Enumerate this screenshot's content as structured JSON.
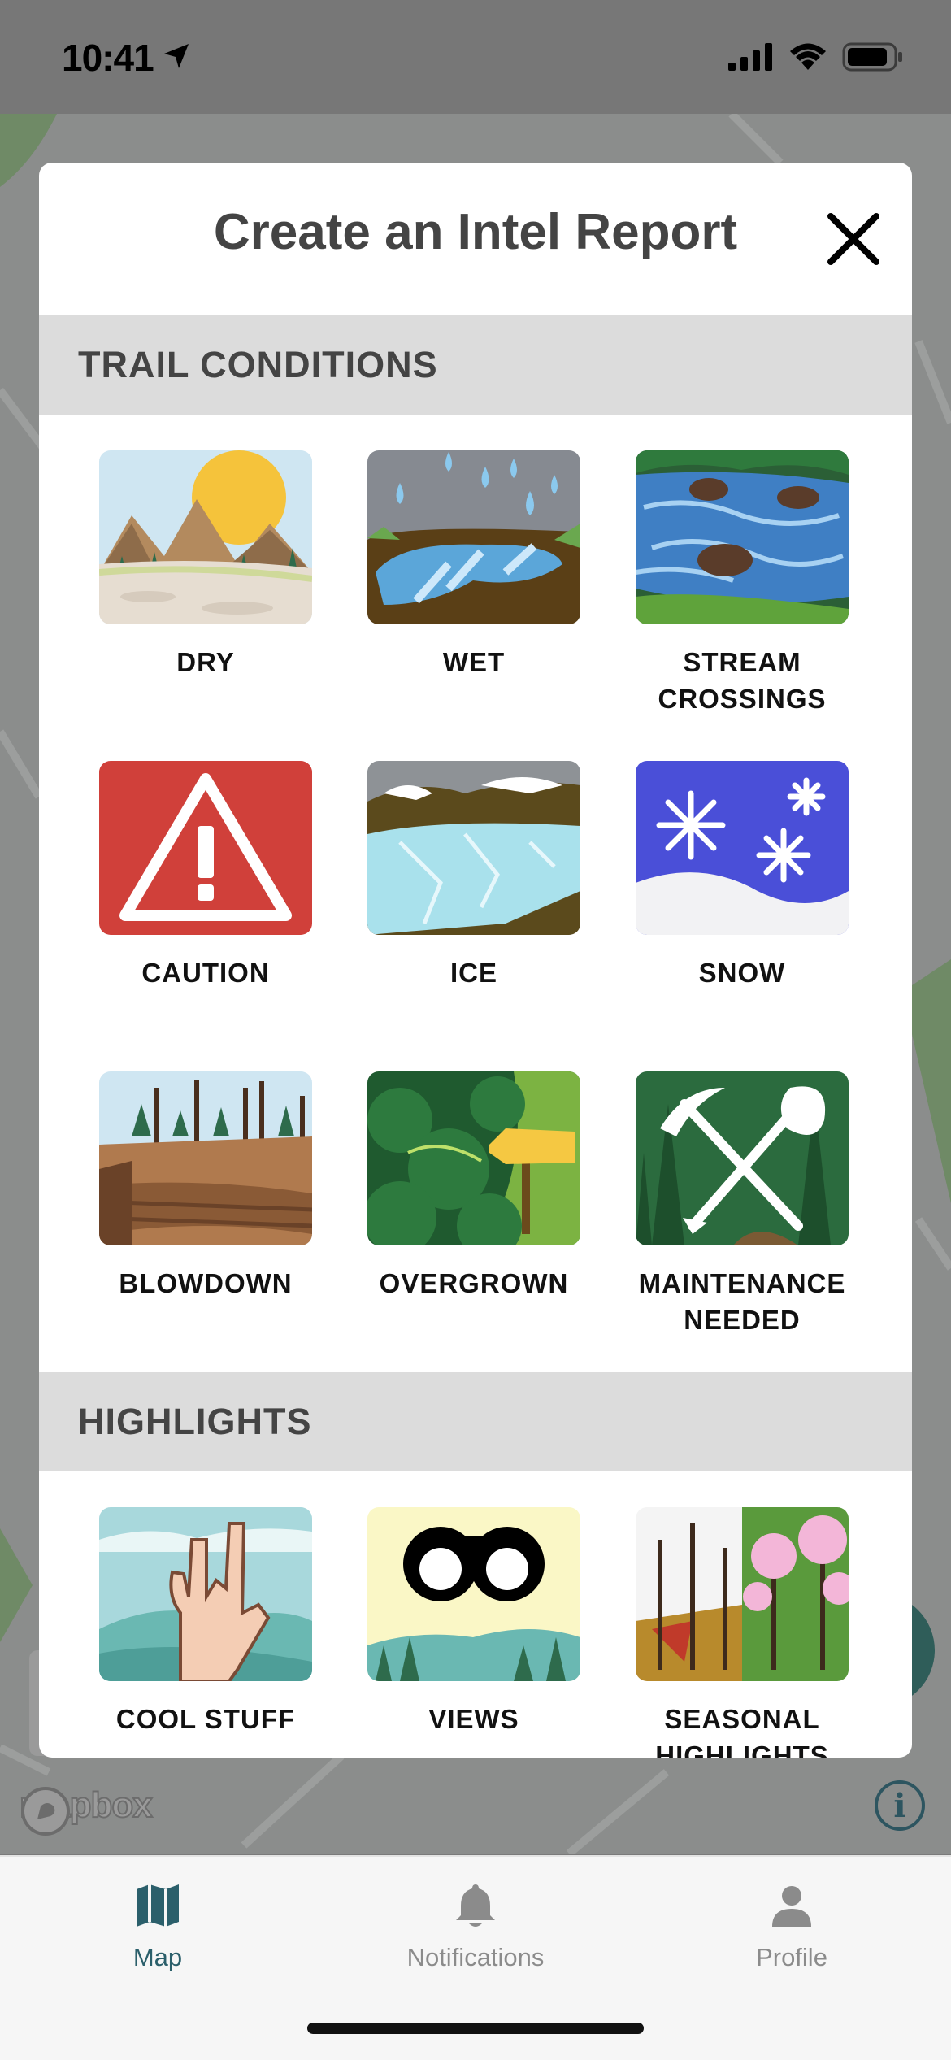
{
  "status_bar": {
    "time": "10:41"
  },
  "map": {
    "attribution_logo": "mapbox",
    "info_icon": "i"
  },
  "modal": {
    "title": "Create an Intel Report",
    "close_icon": "close-icon",
    "sections": [
      {
        "title": "TRAIL CONDITIONS",
        "items": [
          {
            "label": "DRY",
            "icon": "dry-icon"
          },
          {
            "label": "WET",
            "icon": "wet-icon"
          },
          {
            "label": "STREAM\nCROSSINGS",
            "icon": "stream-crossings-icon"
          },
          {
            "label": "CAUTION",
            "icon": "caution-icon"
          },
          {
            "label": "ICE",
            "icon": "ice-icon"
          },
          {
            "label": "SNOW",
            "icon": "snow-icon"
          },
          {
            "label": "BLOWDOWN",
            "icon": "blowdown-icon"
          },
          {
            "label": "OVERGROWN",
            "icon": "overgrown-icon"
          },
          {
            "label": "MAINTENANCE\nNEEDED",
            "icon": "maintenance-needed-icon"
          }
        ]
      },
      {
        "title": "HIGHLIGHTS",
        "items": [
          {
            "label": "COOL STUFF",
            "icon": "cool-stuff-icon"
          },
          {
            "label": "VIEWS",
            "icon": "views-icon"
          },
          {
            "label": "SEASONAL\nHIGHLIGHTS",
            "icon": "seasonal-highlights-icon"
          }
        ]
      }
    ]
  },
  "tabbar": {
    "tabs": [
      {
        "label": "Map",
        "icon": "map-icon",
        "active": true
      },
      {
        "label": "Notifications",
        "icon": "bell-icon",
        "active": false
      },
      {
        "label": "Profile",
        "icon": "person-icon",
        "active": false
      }
    ]
  },
  "colors": {
    "accent": "#2b5f6b",
    "section_bar": "#dcdcdc",
    "title_text": "#444444",
    "caution_red": "#d0403a",
    "snow_blue": "#4a4fd8"
  }
}
